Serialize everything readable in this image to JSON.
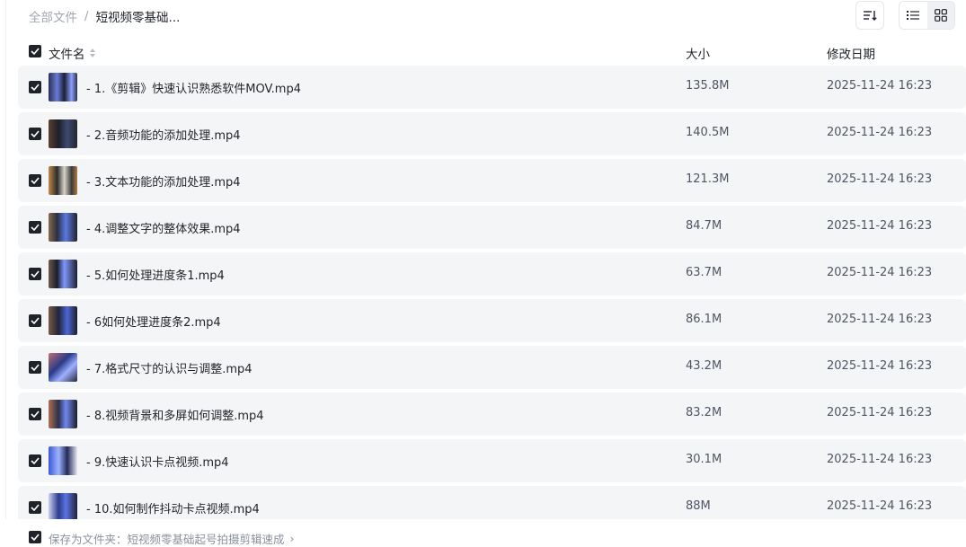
{
  "breadcrumb": {
    "root": "全部文件",
    "separator": "/",
    "current": "短视频零基础..."
  },
  "toolbar": {
    "sort_icon": "sort-lines-icon",
    "list_icon": "list-view-icon",
    "grid_icon": "grid-view-icon"
  },
  "table": {
    "headers": {
      "name": "文件名",
      "size": "大小",
      "date": "修改日期"
    },
    "rows": [
      {
        "name": "- 1.《剪辑》快速认识熟悉软件MOV.mp4",
        "size": "135.8M",
        "date": "2025-11-24 16:23"
      },
      {
        "name": "- 2.音频功能的添加处理.mp4",
        "size": "140.5M",
        "date": "2025-11-24 16:23"
      },
      {
        "name": "- 3.文本功能的添加处理.mp4",
        "size": "121.3M",
        "date": "2025-11-24 16:23"
      },
      {
        "name": "- 4.调整文字的整体效果.mp4",
        "size": "84.7M",
        "date": "2025-11-24 16:23"
      },
      {
        "name": "- 5.如何处理进度条1.mp4",
        "size": "63.7M",
        "date": "2025-11-24 16:23"
      },
      {
        "name": "- 6如何处理进度条2.mp4",
        "size": "86.1M",
        "date": "2025-11-24 16:23"
      },
      {
        "name": "- 7.格式尺寸的认识与调整.mp4",
        "size": "43.2M",
        "date": "2025-11-24 16:23"
      },
      {
        "name": "- 8.视频背景和多屏如何调整.mp4",
        "size": "83.2M",
        "date": "2025-11-24 16:23"
      },
      {
        "name": "- 9.快速认识卡点视频.mp4",
        "size": "30.1M",
        "date": "2025-11-24 16:23"
      },
      {
        "name": "- 10.如何制作抖动卡点视频.mp4",
        "size": "88M",
        "date": "2025-11-24 16:23"
      }
    ]
  },
  "footer": {
    "save_path": "保存为文件夹：短视频零基础起号拍摄剪辑速成",
    "chevron": "›"
  },
  "colors": {
    "row_bg": "#f4f5f7",
    "checkbox": "#1f2329",
    "muted": "#a0a6b0"
  }
}
